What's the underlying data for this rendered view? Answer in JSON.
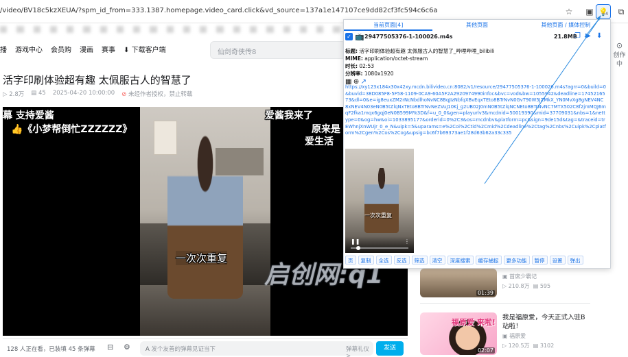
{
  "browser": {
    "url": "/video/BV18c5kzXEUA/?spm_id_from=333.1387.homepage.video_card.click&vd_source=137a1e147107ce9dd82cf3fc594c6c6a",
    "extension_badge": "4"
  },
  "site": {
    "nav_items": [
      "播",
      "游戏中心",
      "会员购",
      "漫画",
      "赛事",
      "下载客户端"
    ],
    "search_placeholder": "仙剑奇侠传8",
    "creator_label": "创作中"
  },
  "video": {
    "title": "活字印刷体验超有趣 太佩服古人的智慧了",
    "views": "2.8万",
    "danmaku_count": "45",
    "date": "2025-04-20 10:00:00",
    "notice": "未经作者授权，禁止转载",
    "danmaku": [
      "幕 支持爱酱",
      "👍《小梦帮倒忙ZZZZZZ》",
      "爱酱我来了",
      "原来是",
      "爱生活"
    ],
    "subtitle": "一次次重复",
    "viewers_text": "128 人正在看，已装填 45 条弹幕",
    "danmaku_input_placeholder": "发个友善的弹幕见证当下",
    "danmaku_etiquette": "弹幕礼仪 >",
    "send_label": "发送"
  },
  "recommendations": [
    {
      "duration": "01:39",
      "uploader": "首席少霸记",
      "views": "210.8万",
      "comments": "595"
    },
    {
      "title": "我是福原爱，今天正式入驻B站啦！",
      "uploader": "福原爱",
      "views": "120.5万",
      "comments": "3102",
      "duration": "02:07",
      "thumb_text": "福原爱 来啦!"
    }
  ],
  "popup": {
    "tabs": [
      "当前页面[4]",
      "其他页面",
      "其他页面 / 媒体控制"
    ],
    "file_name": "29477505376-1-100026.m4s",
    "file_size": "21.8MB",
    "title_label": "标题:",
    "title_value": "活字印刷体验超有趣 太佩服古人的智慧了_哔哩哔哩_bilibili",
    "mime_label": "MIME:",
    "mime_value": "application/octet-stream",
    "duration_label": "时长:",
    "duration_value": "02:53",
    "resolution_label": "分辨率:",
    "resolution_value": "1080x1920",
    "link": "https://xy123x184x30x42xy.mcdn.bilivideo.cn:8082/v1/resource/29477505376-1-100026.m4s?agrr=0&build=0&buvid=38D085F8-5F58-1109-0CA9-60A5F2A2920974990infoc&bvc=vod&bw=1055942&deadline=1745216573&dl=0&e=ig8euxZM2rNcNbdlhoNvNC8BqJIzNbfqXBvEqxTEto8BTrNvN0GvT90W5JZMkX_YN0MvXg8gNEV4NC8xNEV4N03eN0B5tZlqNxTEto8BTrNvNeZVuJ10Kj_g2UB02J0mN0B5tZlqNCNEto8BTrNvNC7MTX502C8f2jmMQJ6mqF2fka1mqx6gqj0eN0B599M%3D&f=u_0_0&gen=playurlv3&mcdnid=50019390&mid=37709031&nbs=1&nettype=0&og=hw&oi=1033895177&orderid=0%2C3&os=mcdnbv&platform=pc&sign=9de15d&tag=&traceid=trEWhnjXnWUjr_0_e_N&uipk=5&uparams=e%2Coi%2Ctid%2Cmid%2Cdeadline%2Ctag%2Cnbs%2Cuipk%2Cplatform%2Cgen%2Cos%2Cog&upsig=bc6f7b69373ae1f28d63b62a33c335",
    "buttons": [
      "复制",
      "全选",
      "反选",
      "筛选",
      "清空",
      "深度搜索",
      "缓存捕捉",
      "更多功能",
      "暂停",
      "设置",
      "弹出"
    ],
    "first_button_partial": "页"
  },
  "watermark": "启创网:q1"
}
